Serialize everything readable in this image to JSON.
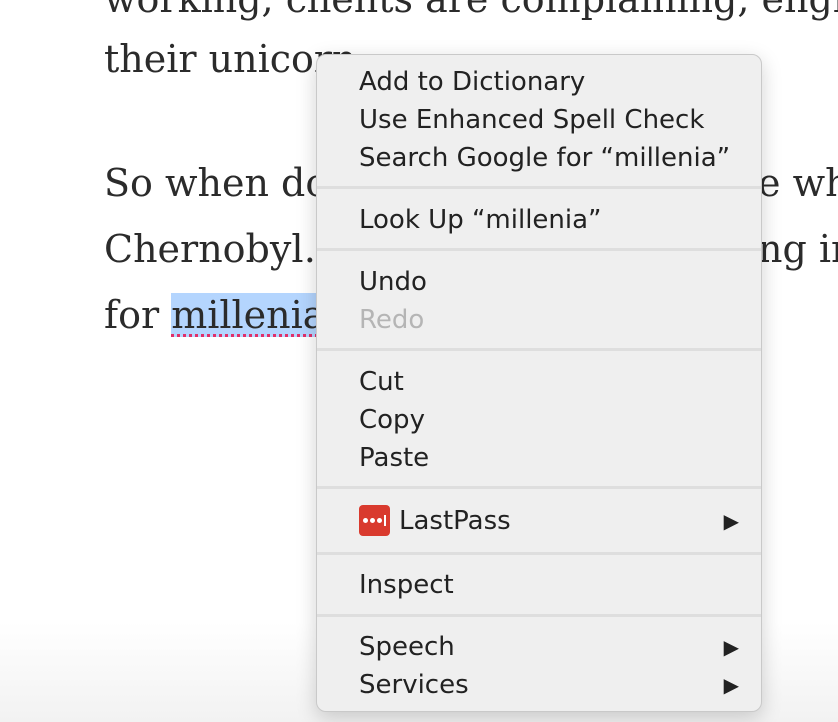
{
  "article": {
    "line0": "working, clients are complaining, engine",
    "line1": "their unicorn",
    "line2": "So when do",
    "line2_right": "e wh",
    "line3": "Chernobyl…",
    "line3_right": "ng im",
    "line4_prefix": "for ",
    "selected_word": "millenia"
  },
  "context_menu": {
    "add_to_dictionary": "Add to Dictionary",
    "enhanced_spell_check": "Use Enhanced Spell Check",
    "search_google": "Search Google for “millenia”",
    "look_up": "Look Up “millenia”",
    "undo": "Undo",
    "redo": "Redo",
    "cut": "Cut",
    "copy": "Copy",
    "paste": "Paste",
    "lastpass": "LastPass",
    "inspect": "Inspect",
    "speech": "Speech",
    "services": "Services",
    "submenu_arrow": "▶"
  },
  "icons": {
    "lastpass_icon": "lastpass-icon",
    "submenu": "chevron-right-icon"
  },
  "colors": {
    "selection": "#b4d5fe",
    "spell_underline": "#e0306a",
    "lastpass_brand": "#d93a2e",
    "disabled_text": "#b5b5b5"
  }
}
